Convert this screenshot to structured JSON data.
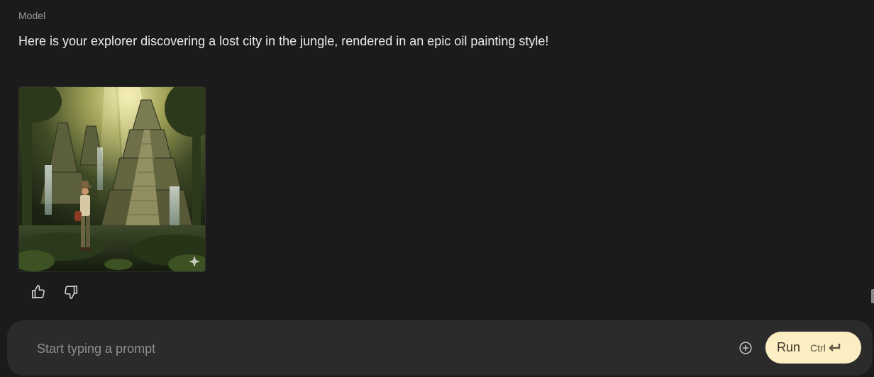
{
  "conversation": {
    "role_label": "Model",
    "message_text": "Here is your explorer discovering a lost city in the jungle, rendered in an epic oil painting style!",
    "image": {
      "icon": "sparkle-icon"
    }
  },
  "feedback": {
    "thumbs_up_icon": "thumbs-up-icon",
    "thumbs_down_icon": "thumbs-down-icon"
  },
  "prompt": {
    "placeholder": "Start typing a prompt",
    "value": "",
    "add_icon": "plus-circle-icon",
    "run_label": "Run",
    "shortcut_label": "Ctrl",
    "shortcut_icon": "enter-key-icon"
  },
  "colors": {
    "background": "#1b1b1b",
    "prompt_bar": "#2b2b2b",
    "run_button": "#fbeec3"
  }
}
